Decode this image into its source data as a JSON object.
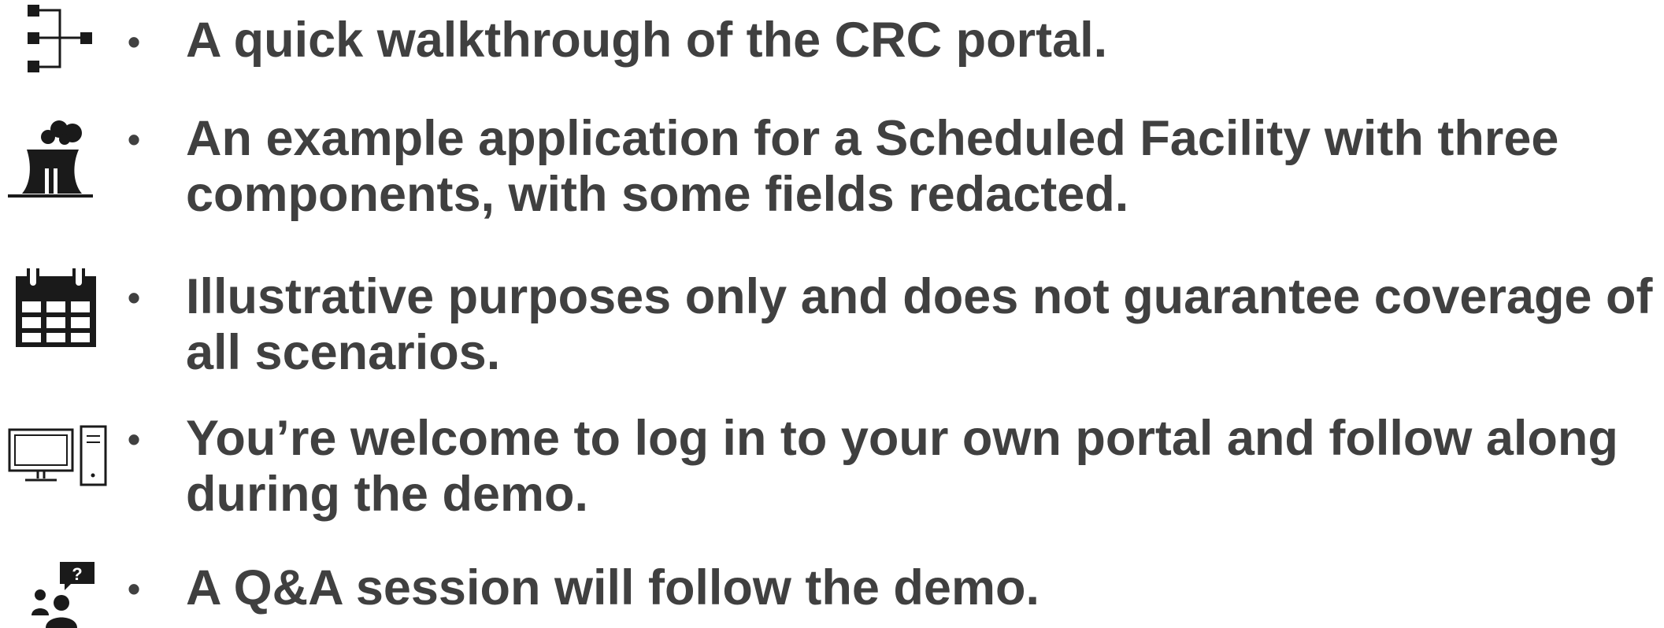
{
  "bullet_char": "•",
  "colors": {
    "text": "#404040",
    "icon": "#1a1a1a"
  },
  "items": [
    {
      "icon": "hierarchy-icon",
      "lines": [
        "A quick walkthrough of the CRC portal."
      ]
    },
    {
      "icon": "factory-icon",
      "lines": [
        "An example application for a Scheduled Facility with three",
        "components, with some fields redacted."
      ]
    },
    {
      "icon": "calendar-icon",
      "lines": [
        "Illustrative purposes only and does not guarantee coverage of",
        "all scenarios."
      ]
    },
    {
      "icon": "desktop-computer-icon",
      "lines": [
        "You’re welcome to log in to your own portal and follow along",
        "during the demo."
      ]
    },
    {
      "icon": "question-people-icon",
      "lines": [
        "A Q&A session will follow the demo."
      ]
    }
  ]
}
